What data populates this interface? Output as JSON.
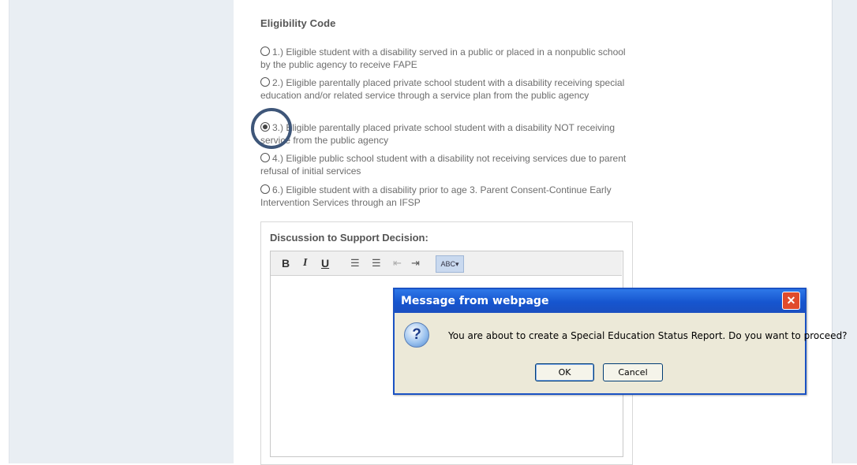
{
  "eligibility": {
    "title": "Eligibility Code",
    "options": [
      {
        "label": "1.) Eligible student with a disability served in a public or placed in a nonpublic school by the public agency to receive FAPE",
        "checked": false
      },
      {
        "label": "2.) Eligible parentally placed private school student with a disability receiving special education and/or related service through a service plan from the public agency",
        "checked": false
      },
      {
        "label": "3.) Eligible parentally placed private school student with a disability NOT receiving service from the public agency",
        "checked": true
      },
      {
        "label": "4.) Eligible public school student with a disability not receiving services due to parent refusal of initial services",
        "checked": false
      },
      {
        "label": "6.) Eligible student with a disability prior to age 3. Parent Consent-Continue Early Intervention Services through an IFSP",
        "checked": false
      }
    ]
  },
  "discussion": {
    "label": "Discussion to Support Decision:",
    "toolbar": {
      "bold": "B",
      "italic": "I",
      "underline": "U",
      "spellcheck": "ABC▾"
    }
  },
  "dialog": {
    "title": "Message from webpage",
    "close": "✕",
    "icon": "?",
    "message": "You are about to create a Special Education Status Report. Do you want to proceed?",
    "ok": "OK",
    "cancel": "Cancel"
  },
  "colors": {
    "highlight_circle": "#3e5679",
    "dialog_title_bar": "#1655cf"
  },
  "icons": [
    "question-icon",
    "close-icon",
    "numbered-list-icon",
    "bullet-list-icon",
    "outdent-icon",
    "indent-icon",
    "spellcheck-icon",
    "radio-icon"
  ]
}
